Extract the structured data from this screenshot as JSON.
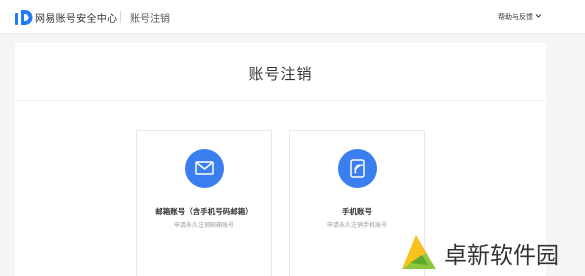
{
  "header": {
    "brand": "网易账号安全中心",
    "section": "账号注销",
    "help_label": "帮助与反馈",
    "logo_icon": "netease-id-logo",
    "chevron_icon": "chevron-down-icon"
  },
  "main": {
    "title": "账号注销",
    "options": [
      {
        "title": "邮箱账号（含手机号码邮箱）",
        "description": "申请永久注销邮箱账号",
        "icon": "mail-icon",
        "color": "#3a7ef0"
      },
      {
        "title": "手机账号",
        "description": "申请永久注销手机账号",
        "icon": "phone-icon",
        "color": "#3a7ef0"
      }
    ]
  },
  "watermark": {
    "text": "卓新软件园"
  },
  "colors": {
    "accent": "#3a7ef0",
    "logo_blue": "#1f7cf4"
  }
}
